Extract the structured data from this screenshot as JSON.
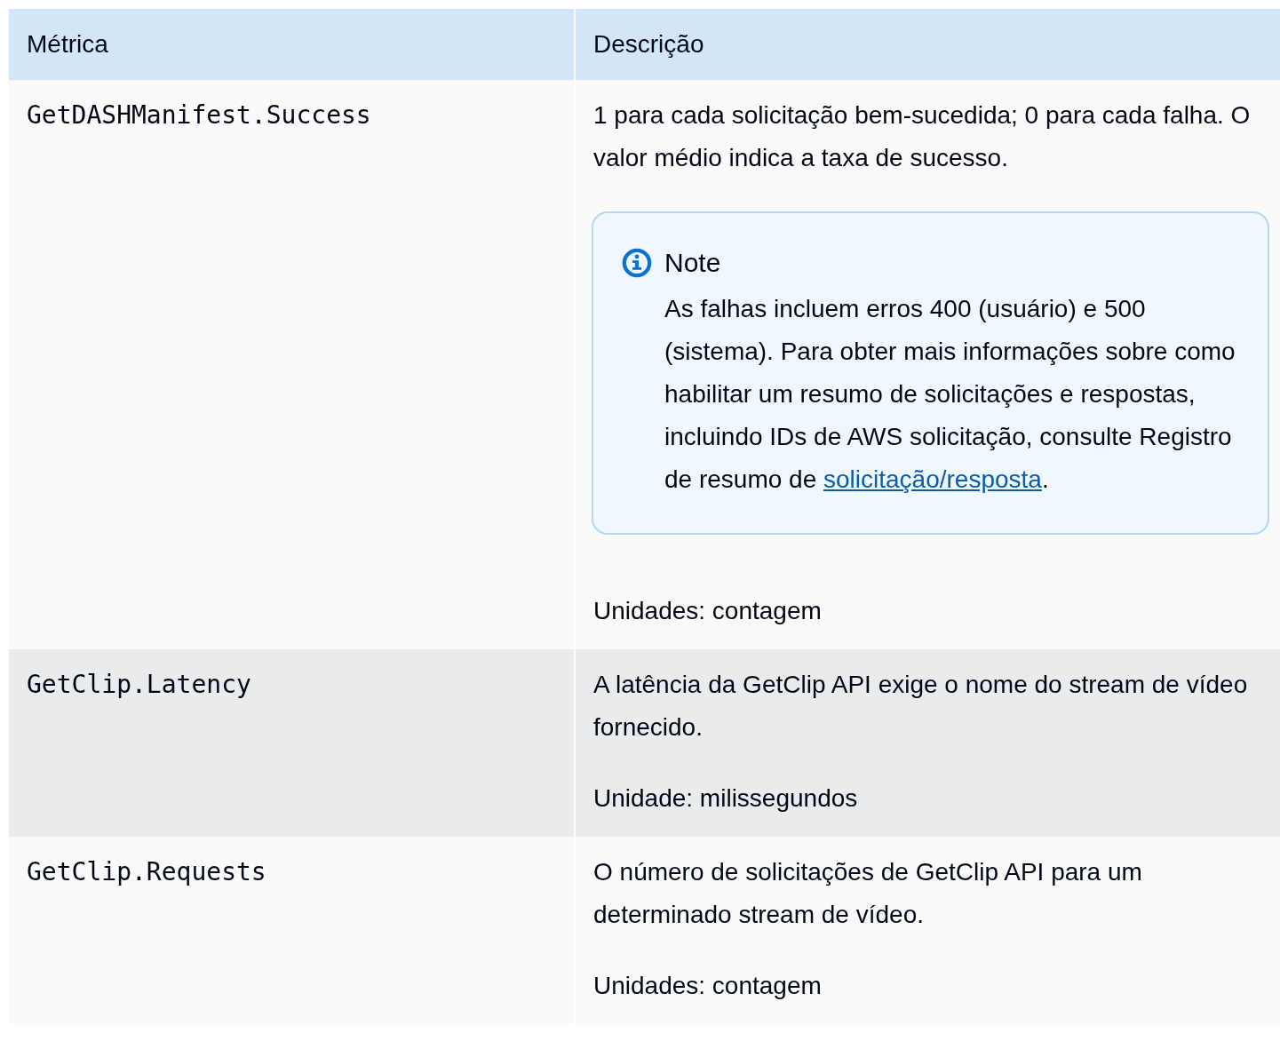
{
  "table": {
    "columns": [
      "Métrica",
      "Descrição"
    ],
    "rows": [
      {
        "metric": "GetDASHManifest.Success",
        "description": [
          {
            "kind": "text",
            "text": "1 para cada solicitação bem-sucedida; 0 para cada falha. O valor médio indica a taxa de sucesso."
          },
          {
            "kind": "note",
            "title": "Note",
            "text": "As falhas incluem erros 400 (usuário) e 500 (sistema). Para obter mais informações sobre como habilitar um resumo de solicitações e respostas, incluindo IDs de AWS solicitação, consulte Registro de resumo de ",
            "link": "solicitação/resposta",
            "after": "."
          },
          {
            "kind": "text",
            "text": "Unidades: contagem"
          }
        ]
      },
      {
        "metric": "GetClip.Latency",
        "description": [
          {
            "kind": "text",
            "text": "A latência da GetClip API exige o nome do stream de vídeo fornecido."
          },
          {
            "kind": "text",
            "text": "Unidade: milissegundos"
          }
        ]
      },
      {
        "metric": "GetClip.Requests",
        "description": [
          {
            "kind": "text",
            "text": "O número de solicitações de GetClip API para um determinado stream de vídeo."
          },
          {
            "kind": "text",
            "text": "Unidades: contagem"
          }
        ]
      }
    ]
  }
}
